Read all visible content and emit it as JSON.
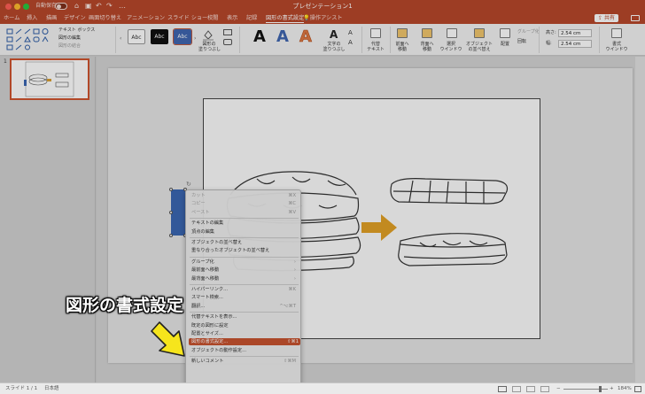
{
  "titlebar": {
    "autosave_label": "自動保存",
    "toggle_label": "オフ",
    "document_title": "プレゼンテーション1",
    "colors": {
      "accent": "#b7472a"
    }
  },
  "tabs": [
    "ホーム",
    "挿入",
    "描画",
    "デザイン",
    "画面切り替え",
    "アニメーション",
    "スライド ショー",
    "校閲",
    "表示",
    "記録",
    "図形の書式設定",
    "操作アシスト"
  ],
  "active_tab": "図形の書式設定",
  "share_label": "共有",
  "ribbon": {
    "insert_shapes": {
      "text_box": "テキスト ボックス",
      "edit_shape": "図形の編集",
      "merge_shapes": "図形の結合"
    },
    "shape_styles": [
      "Abc",
      "Abc",
      "Abc"
    ],
    "shape_fill": "図形の\n塗りつぶし",
    "wordart_letters": [
      "A",
      "A",
      "A"
    ],
    "text_fill": "文字の\n塗りつぶし",
    "alt_text": "代替\nテキスト",
    "bring_forward": "前面へ\n移動",
    "send_backward": "背面へ\n移動",
    "selection_pane": "選択\nウインドウ",
    "reorder": "オブジェクト\nの並べ替え",
    "align": "配置",
    "group": "グループ化",
    "rotate": "回転",
    "height_label": "高さ:",
    "height_value": "2.54 cm",
    "width_label": "幅:",
    "width_value": "2.54 cm",
    "format_pane": "書式\nウインドウ"
  },
  "slide_panel": {
    "slide_number": "1"
  },
  "context_menu": {
    "items": [
      {
        "label": "カット",
        "shortcut": "⌘X",
        "disabled": true
      },
      {
        "label": "コピー",
        "shortcut": "⌘C",
        "disabled": true
      },
      {
        "label": "ペースト",
        "shortcut": "⌘V",
        "disabled": true
      },
      {
        "sep": true
      },
      {
        "label": "テキストの編集",
        "shortcut": "",
        "disabled": false
      },
      {
        "label": "頂点の編集",
        "shortcut": "",
        "disabled": false
      },
      {
        "sep": true
      },
      {
        "label": "オブジェクトの並べ替え",
        "shortcut": "",
        "disabled": false
      },
      {
        "label": "重なり合ったオブジェクトの並べ替え",
        "shortcut": "",
        "disabled": false
      },
      {
        "sep": true
      },
      {
        "label": "グループ化",
        "shortcut": "›",
        "disabled": false
      },
      {
        "label": "最前面へ移動",
        "shortcut": "›",
        "disabled": false
      },
      {
        "label": "最背面へ移動",
        "shortcut": "›",
        "disabled": false
      },
      {
        "sep": true
      },
      {
        "label": "ハイパーリンク...",
        "shortcut": "⌘K",
        "disabled": false
      },
      {
        "label": "スマート検索...",
        "shortcut": "",
        "disabled": false
      },
      {
        "label": "翻訳...",
        "shortcut": "^⌥⌘T",
        "disabled": false
      },
      {
        "sep": true
      },
      {
        "label": "代替テキストを表示...",
        "shortcut": "",
        "disabled": false
      },
      {
        "label": "既定の図形に設定",
        "shortcut": "",
        "disabled": false
      },
      {
        "label": "配置とサイズ...",
        "shortcut": "",
        "disabled": false
      },
      {
        "label": "図形の書式設定...",
        "shortcut": "⇧⌘1",
        "disabled": false,
        "highlighted": true
      },
      {
        "label": "オブジェクトの動作設定...",
        "shortcut": "",
        "disabled": false
      },
      {
        "sep": true
      },
      {
        "label": "新しいコメント",
        "shortcut": "⇧⌘M",
        "disabled": false
      }
    ]
  },
  "callout_text": "図形の書式設定",
  "statusbar": {
    "slide_info": "スライド 1 / 1",
    "language": "日本語",
    "zoom": "184%"
  }
}
